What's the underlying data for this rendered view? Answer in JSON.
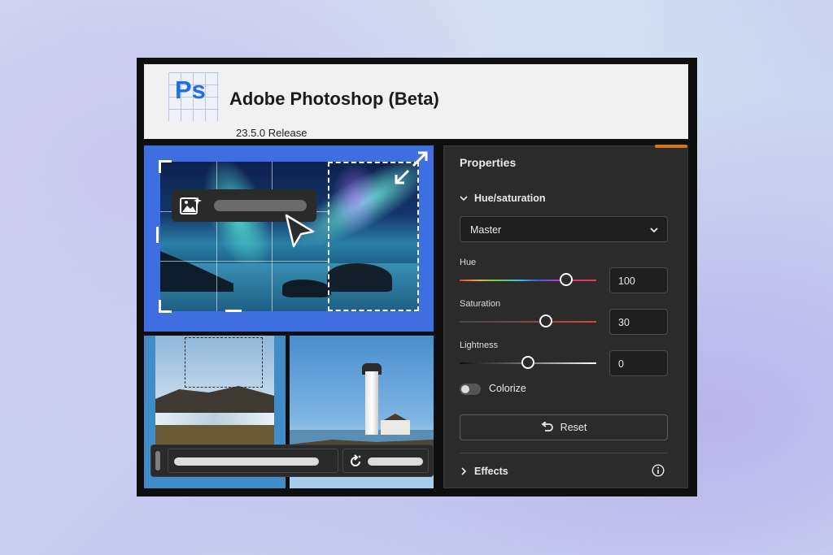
{
  "app": {
    "logo_text": "Ps",
    "title": "Adobe Photoshop (Beta)",
    "version": "23.5.0 Release"
  },
  "properties": {
    "title": "Properties",
    "section": "Hue/saturation",
    "channel": "Master",
    "sliders": [
      {
        "label": "Hue",
        "value": "100",
        "level": 0.78
      },
      {
        "label": "Saturation",
        "value": "30",
        "level": 0.63
      },
      {
        "label": "Lightness",
        "value": "0",
        "level": 0.5
      }
    ],
    "colorize_label": "Colorize",
    "reset_label": "Reset",
    "effects_label": "Effects"
  },
  "colors": {
    "ps_blue": "#1f6fe8",
    "panel_bg": "#2b2b2b",
    "selection_blue": "#3d6fe0",
    "accent_orange": "#d9751f"
  },
  "icons": {
    "generative_fill": "image-sparkle-icon",
    "regenerate": "regenerate-icon",
    "expand": "expand-arrow-icon",
    "reset": "undo-icon",
    "info": "info-icon"
  }
}
